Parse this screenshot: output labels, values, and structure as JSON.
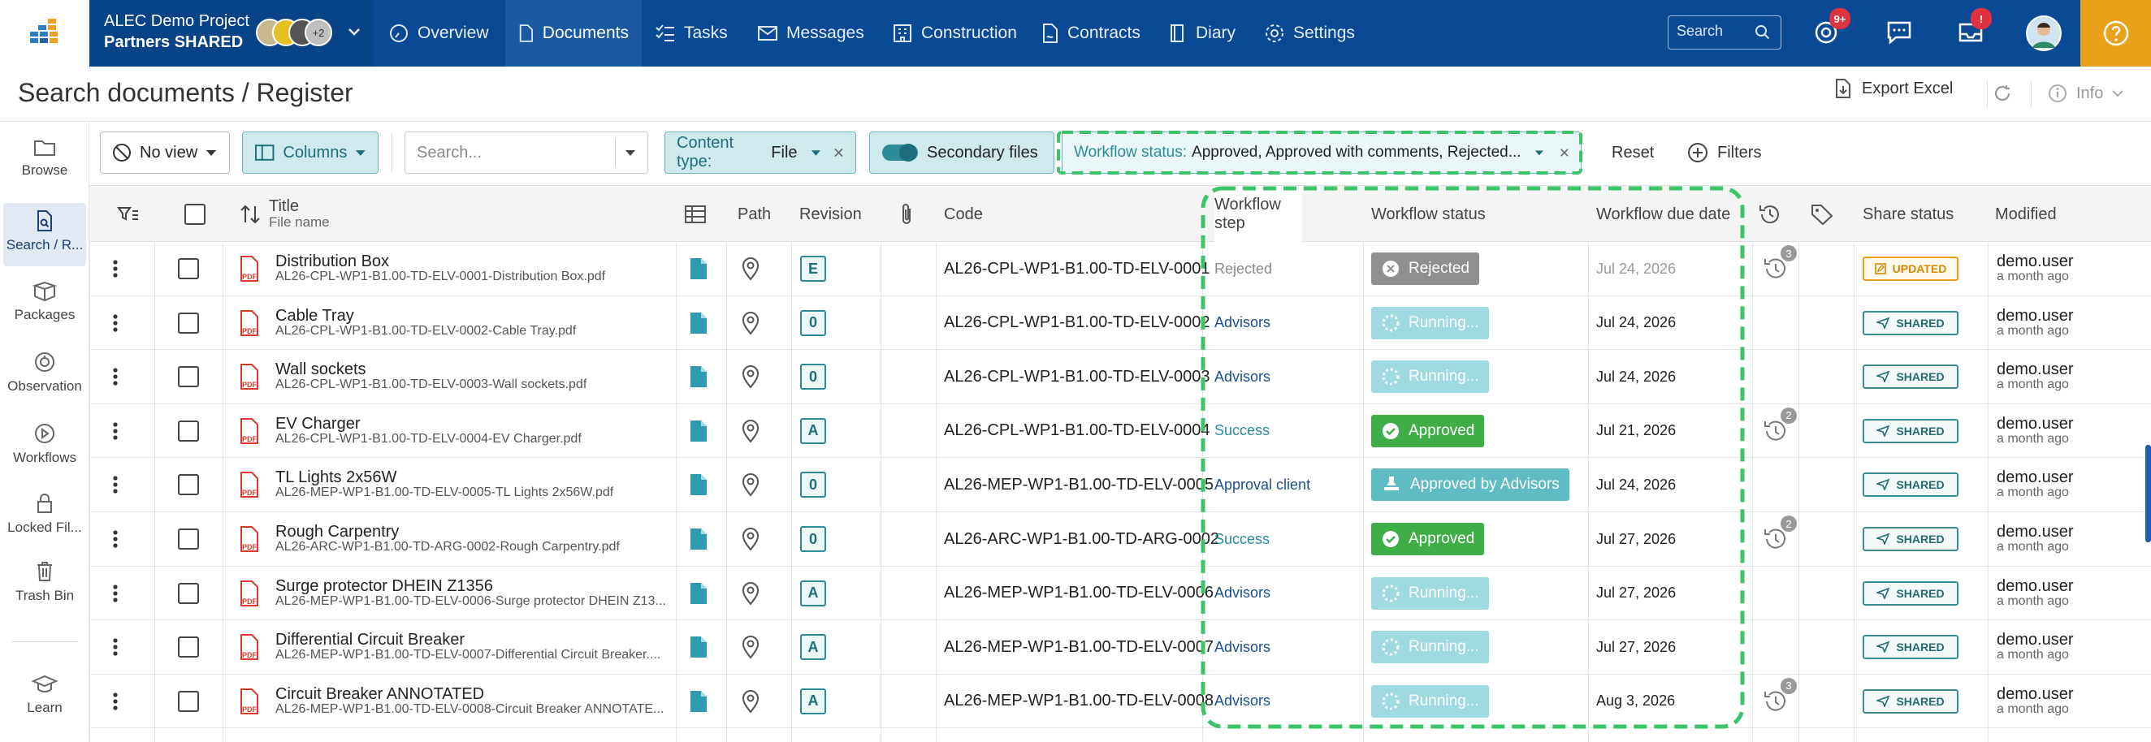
{
  "project": {
    "name": "ALEC Demo Project",
    "team": "Partners SHARED",
    "more_members": "+2"
  },
  "nav": [
    {
      "label": "Overview",
      "icon": "overview-icon"
    },
    {
      "label": "Documents",
      "icon": "document-icon",
      "active": true
    },
    {
      "label": "Tasks",
      "icon": "tasks-icon"
    },
    {
      "label": "Messages",
      "icon": "mail-icon"
    },
    {
      "label": "Construction",
      "icon": "building-icon"
    },
    {
      "label": "Contracts",
      "icon": "contract-icon"
    },
    {
      "label": "Diary",
      "icon": "book-icon"
    },
    {
      "label": "Settings",
      "icon": "gear-icon"
    }
  ],
  "topbar": {
    "search_placeholder": "Search",
    "mentions_badge": "9+",
    "inbox_badge": "!"
  },
  "page": {
    "title": "Search documents / Register",
    "export_label": "Export Excel",
    "info_label": "Info"
  },
  "sidebar": [
    {
      "label": "Browse",
      "icon": "folder-icon"
    },
    {
      "label": "Search / R...",
      "icon": "file-search-icon",
      "active": true
    },
    {
      "label": "Packages",
      "icon": "package-icon"
    },
    {
      "label": "Observation",
      "icon": "observation-icon"
    },
    {
      "label": "Workflows",
      "icon": "workflow-icon"
    },
    {
      "label": "Locked Fil...",
      "icon": "lock-icon"
    },
    {
      "label": "Trash Bin",
      "icon": "trash-icon"
    },
    {
      "label": "Learn",
      "icon": "graduation-cap-icon"
    }
  ],
  "toolbar": {
    "view_label": "No view",
    "columns_label": "Columns",
    "search_placeholder": "Search...",
    "content_type_key": "Content type:",
    "content_type_value": "File",
    "secondary_files_label": "Secondary files",
    "workflow_status_key": "Workflow status:",
    "workflow_status_value": "Approved, Approved with comments, Rejected...",
    "reset_label": "Reset",
    "filters_label": "Filters"
  },
  "columns": {
    "title": "Title",
    "file_name": "File name",
    "path": "Path",
    "revision": "Revision",
    "code": "Code",
    "workflow_step": "Workflow step",
    "workflow_status": "Workflow status",
    "workflow_due": "Workflow due date",
    "share_status": "Share status",
    "modified": "Modified"
  },
  "rows": [
    {
      "title": "Distribution Box",
      "file": "AL26-CPL-WP1-B1.00-TD-ELV-0001-Distribution Box.pdf",
      "revision": "E",
      "code": "AL26-CPL-WP1-B1.00-TD-ELV-0001",
      "step": "Rejected",
      "status": "Rejected",
      "due": "Jul 24, 2026",
      "history": "3",
      "share": "UPDATED",
      "user": "demo.user",
      "ago": "a month ago"
    },
    {
      "title": "Cable Tray",
      "file": "AL26-CPL-WP1-B1.00-TD-ELV-0002-Cable Tray.pdf",
      "revision": "0",
      "code": "AL26-CPL-WP1-B1.00-TD-ELV-0002",
      "step": "Advisors",
      "status": "Running...",
      "due": "Jul 24, 2026",
      "history": "",
      "share": "SHARED",
      "user": "demo.user",
      "ago": "a month ago"
    },
    {
      "title": "Wall sockets",
      "file": "AL26-CPL-WP1-B1.00-TD-ELV-0003-Wall sockets.pdf",
      "revision": "0",
      "code": "AL26-CPL-WP1-B1.00-TD-ELV-0003",
      "step": "Advisors",
      "status": "Running...",
      "due": "Jul 24, 2026",
      "history": "",
      "share": "SHARED",
      "user": "demo.user",
      "ago": "a month ago"
    },
    {
      "title": "EV Charger",
      "file": "AL26-CPL-WP1-B1.00-TD-ELV-0004-EV Charger.pdf",
      "revision": "A",
      "code": "AL26-CPL-WP1-B1.00-TD-ELV-0004",
      "step": "Success",
      "status": "Approved",
      "due": "Jul 21, 2026",
      "history": "2",
      "share": "SHARED",
      "user": "demo.user",
      "ago": "a month ago"
    },
    {
      "title": "TL Lights 2x56W",
      "file": "AL26-MEP-WP1-B1.00-TD-ELV-0005-TL Lights 2x56W.pdf",
      "revision": "0",
      "code": "AL26-MEP-WP1-B1.00-TD-ELV-0005",
      "step": "Approval client",
      "status": "Approved by Advisors",
      "due": "Jul 24, 2026",
      "history": "",
      "share": "SHARED",
      "user": "demo.user",
      "ago": "a month ago"
    },
    {
      "title": "Rough Carpentry",
      "file": "AL26-ARC-WP1-B1.00-TD-ARG-0002-Rough Carpentry.pdf",
      "revision": "0",
      "code": "AL26-ARC-WP1-B1.00-TD-ARG-0002",
      "step": "Success",
      "status": "Approved",
      "due": "Jul 27, 2026",
      "history": "2",
      "share": "SHARED",
      "user": "demo.user",
      "ago": "a month ago"
    },
    {
      "title": "Surge protector DHEIN Z1356",
      "file": "AL26-MEP-WP1-B1.00-TD-ELV-0006-Surge protector DHEIN Z13...",
      "revision": "A",
      "code": "AL26-MEP-WP1-B1.00-TD-ELV-0006",
      "step": "Advisors",
      "status": "Running...",
      "due": "Jul 27, 2026",
      "history": "",
      "share": "SHARED",
      "user": "demo.user",
      "ago": "a month ago"
    },
    {
      "title": "Differential Circuit Breaker",
      "file": "AL26-MEP-WP1-B1.00-TD-ELV-0007-Differential Circuit Breaker....",
      "revision": "A",
      "code": "AL26-MEP-WP1-B1.00-TD-ELV-0007",
      "step": "Advisors",
      "status": "Running...",
      "due": "Jul 27, 2026",
      "history": "",
      "share": "SHARED",
      "user": "demo.user",
      "ago": "a month ago"
    },
    {
      "title": "Circuit Breaker ANNOTATED",
      "file": "AL26-MEP-WP1-B1.00-TD-ELV-0008-Circuit Breaker ANNOTATE...",
      "revision": "A",
      "code": "AL26-MEP-WP1-B1.00-TD-ELV-0008",
      "step": "Advisors",
      "status": "Running...",
      "due": "Aug 3, 2026",
      "history": "3",
      "share": "SHARED",
      "user": "demo.user",
      "ago": "a month ago"
    }
  ],
  "colors": {
    "topbar": "#0a4a94",
    "accent": "#e9a11a",
    "teal": "#2b8c99",
    "approved": "#3fae49",
    "rejected": "#8f8f8f",
    "running": "#9fd9e2",
    "approved_by_advisors": "#5fbcc4",
    "highlight": "#3cc46a"
  }
}
